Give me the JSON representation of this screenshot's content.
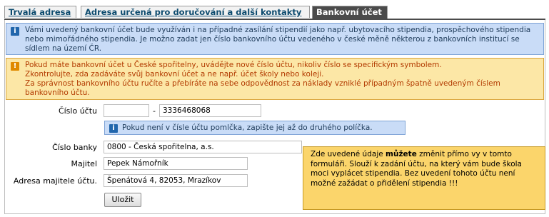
{
  "tabs": [
    {
      "label": "Trvalá adresa"
    },
    {
      "label": "Adresa určená pro doručování a další kontakty"
    },
    {
      "label": "Bankovní účet"
    }
  ],
  "info_message": {
    "icon": "info-icon",
    "text": "Vámi uvedený bankovní účet bude využíván i na případné zasílání stipendií jako např. ubytovacího stipendia, prospěchového stipendia nebo mimořádného stipendia. Je možno zadat jen číslo bankovního účtu vedeného v české měně některou z bankovních institucí se sídlem na území ČR."
  },
  "warning_message": {
    "icon": "warning-icon",
    "line1": "Pokud máte bankovní účet u České spořitelny, uvádějte nové číslo účtu, nikoliv číslo se specifickým symbolem.",
    "line2": "Zkontrolujte, zda zadáváte svůj bankovní účet a ne např. účet školy nebo koleji.",
    "line3": "Za správnost bankovního účtu ručíte a přebíráte na sebe odpovědnost za náklady vzniklé případným špatně uvedeným číslem bankovního účtu."
  },
  "form": {
    "account_number_label": "Číslo účtu",
    "account_prefix_value": "",
    "account_separator": "-",
    "account_number_value": "3336468068",
    "account_hint": "Pokud není v čísle účtu pomlčka, zapište jej až do druhého políčka.",
    "bank_code_label": "Číslo banky",
    "bank_code_value": "0800 - Česká spořitelna, a.s.",
    "owner_label": "Majitel",
    "owner_value": "Pepek Námořník",
    "owner_address_label": "Adresa majitele účtu.",
    "owner_address_value": "Špenátová 4, 82053, Mrazíkov",
    "save_label": "Uložit"
  },
  "tooltip": {
    "text_before": "Zde uvedené údaje ",
    "text_bold": "můžete",
    "text_after": " změnit přímo vy v tomto formuláři. Slouží k zadání účtu, na který vám bude škola moci vyplácet stipendia. Bez uvedení tohoto účtu není možné zažádat o přidělení stipendia !!!"
  },
  "colors": {
    "info_bg": "#c9dcf7",
    "warning_bg": "#fce7a6",
    "warning_text": "#b23a00",
    "tooltip_bg": "#fbd56b",
    "active_tab": "#4b4b4b"
  }
}
